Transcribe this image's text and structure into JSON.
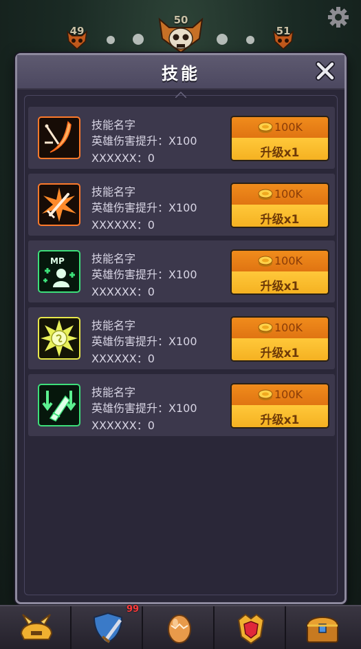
{
  "hud": {
    "level_left": "49",
    "level_center": "50",
    "level_right": "51",
    "settings_icon": "gear-icon"
  },
  "modal": {
    "title": "技能",
    "close_icon": "close-x-icon"
  },
  "skills": [
    {
      "icon": "slash-sword-icon",
      "name": "技能名字",
      "effect": "英雄伤害提升：X100",
      "extra": "XXXXXX：0",
      "cost": "100K",
      "upgrade": "升级x1",
      "icon_color": "#ff7a2a"
    },
    {
      "icon": "burst-sword-icon",
      "name": "技能名字",
      "effect": "英雄伤害提升：X100",
      "extra": "XXXXXX：0",
      "cost": "100K",
      "upgrade": "升级x1",
      "icon_color": "#ff7a2a"
    },
    {
      "icon": "mp-heal-icon",
      "name": "技能名字",
      "effect": "英雄伤害提升：X100",
      "extra": "XXXXXX：0",
      "cost": "100K",
      "upgrade": "升级x1",
      "icon_color": "#3de07a"
    },
    {
      "icon": "star-burst-icon",
      "name": "技能名字",
      "effect": "英雄伤害提升：X100",
      "extra": "XXXXXX：0",
      "cost": "100K",
      "upgrade": "升级x1",
      "icon_color": "#e8e84a"
    },
    {
      "icon": "speed-arrows-icon",
      "name": "技能名字",
      "effect": "英雄伤害提升：X100",
      "extra": "XXXXXX：0",
      "cost": "100K",
      "upgrade": "升级x1",
      "icon_color": "#3de07a"
    }
  ],
  "bottom_nav": {
    "items": [
      "helmet-icon",
      "shield-sword-icon",
      "egg-icon",
      "gem-crest-icon",
      "treasure-chest-icon"
    ],
    "badge": "99"
  },
  "colors": {
    "panel": "#2a2738",
    "row": "#3c384c",
    "cost_orange": "#e07412",
    "upgrade_yellow": "#f4b020"
  }
}
